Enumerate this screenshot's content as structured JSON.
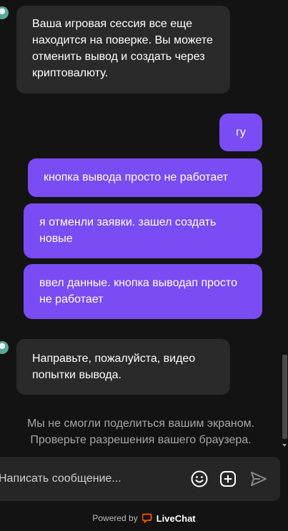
{
  "messages": [
    {
      "from": "agent",
      "text": "Ваша игровая сессия все еще находится на поверке. Вы можете отменить вывод и создать через криптовалюту."
    },
    {
      "from": "user",
      "text": "гу"
    },
    {
      "from": "user",
      "text": "кнопка вывода просто не работает"
    },
    {
      "from": "user",
      "text": "я отменли заявки. зашел создать новые"
    },
    {
      "from": "user",
      "text": "ввел данные. кнопка выводап просто не работает"
    },
    {
      "from": "agent",
      "text": "Направьте, пожалуйста, видео попытки вывода."
    }
  ],
  "system_note": "Мы не смогли поделиться вашим экраном. Проверьте разрешения вашего браузера.",
  "composer": {
    "placeholder": "Написать сообщение..."
  },
  "icons": {
    "emoji": "smile-icon",
    "attach": "plus-square-icon",
    "send": "send-icon"
  },
  "footer": {
    "powered_by": "Powered by",
    "brand": "LiveChat",
    "brand_color": "#ff5100"
  },
  "colors": {
    "background": "#131313",
    "agent_bubble": "#2a2a2a",
    "user_bubble": "#7a4cf4"
  }
}
